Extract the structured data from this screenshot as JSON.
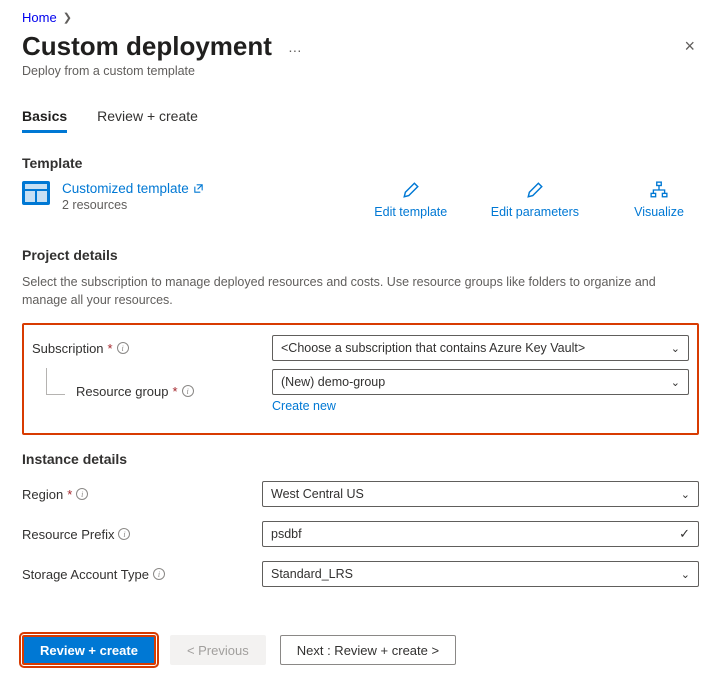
{
  "breadcrumb": {
    "home": "Home"
  },
  "header": {
    "title": "Custom deployment",
    "subtitle": "Deploy from a custom template",
    "more": "…",
    "close": "×"
  },
  "tabs": {
    "basics": "Basics",
    "review": "Review + create"
  },
  "template": {
    "section_label": "Template",
    "name": "Customized template",
    "resources": "2 resources",
    "actions": {
      "edit_template": "Edit template",
      "edit_parameters": "Edit parameters",
      "visualize": "Visualize"
    }
  },
  "project": {
    "section_label": "Project details",
    "description": "Select the subscription to manage deployed resources and costs. Use resource groups like folders to organize and manage all your resources.",
    "subscription_label": "Subscription",
    "subscription_value": "<Choose a subscription that contains Azure Key Vault>",
    "resource_group_label": "Resource group",
    "resource_group_value": "(New) demo-group",
    "create_new": "Create new"
  },
  "instance": {
    "section_label": "Instance details",
    "region_label": "Region",
    "region_value": "West Central US",
    "prefix_label": "Resource Prefix",
    "prefix_value": "psdbf",
    "storage_label": "Storage Account Type",
    "storage_value": "Standard_LRS"
  },
  "footer": {
    "review_create": "Review + create",
    "previous": "< Previous",
    "next": "Next : Review + create >"
  },
  "required_marker": "*"
}
